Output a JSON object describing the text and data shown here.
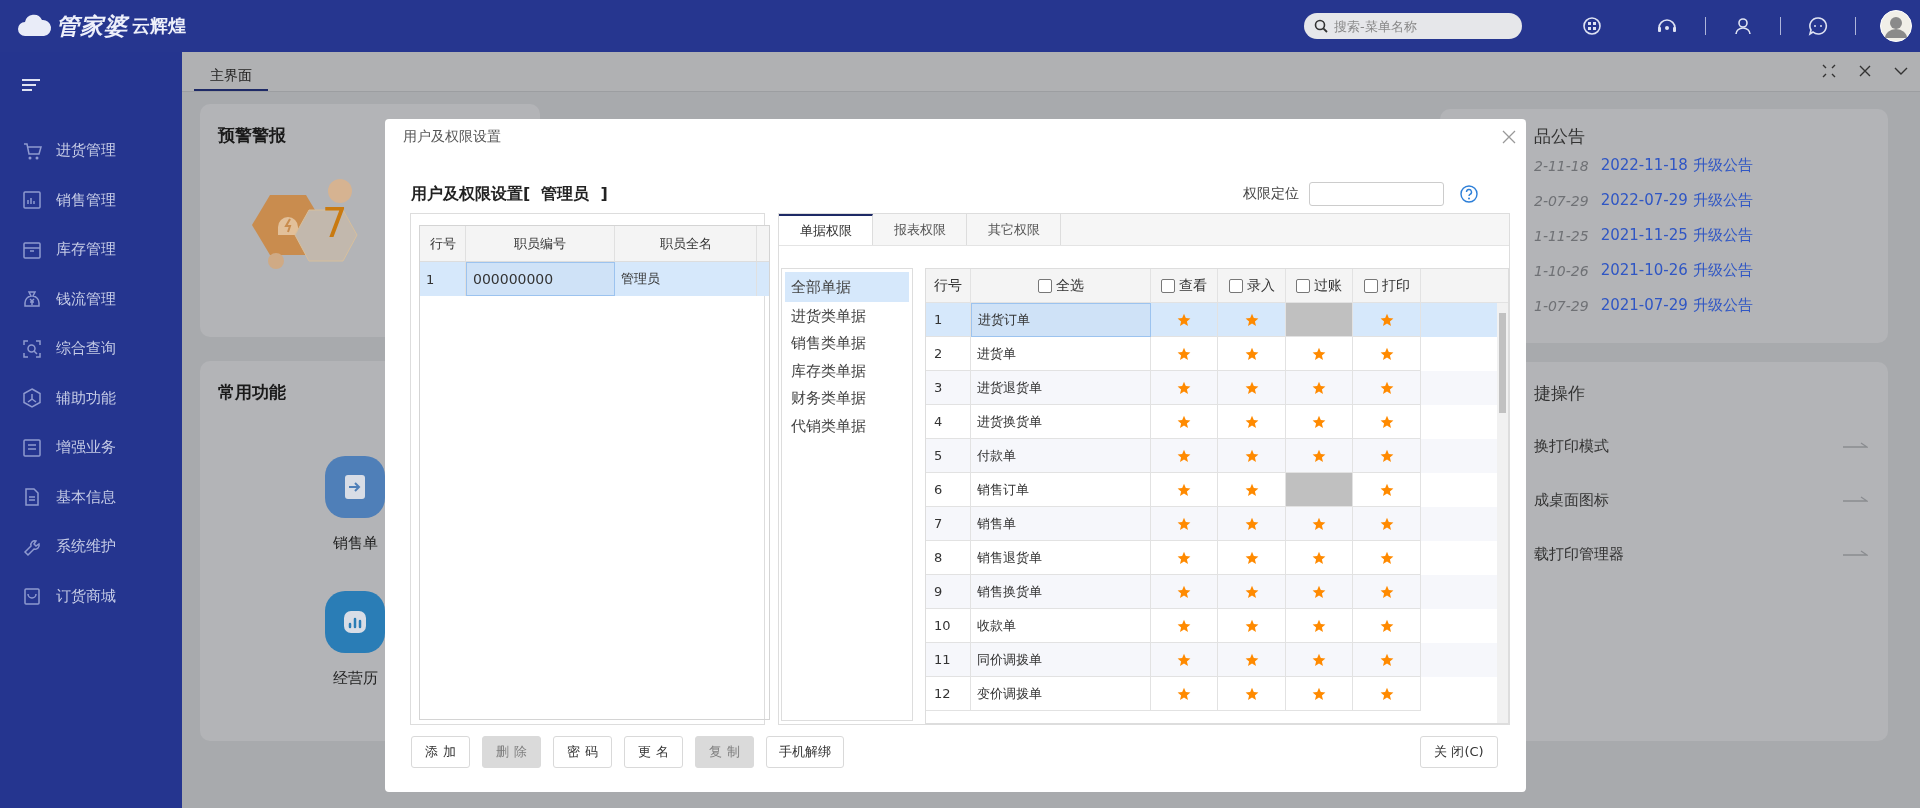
{
  "topbar": {
    "logo": {
      "brand": "管家婆",
      "product": "云辉煌"
    },
    "search": {
      "placeholder": "搜索-菜单名称"
    }
  },
  "sidebar": {
    "items": [
      {
        "label": "进货管理"
      },
      {
        "label": "销售管理"
      },
      {
        "label": "库存管理"
      },
      {
        "label": "钱流管理"
      },
      {
        "label": "综合查询"
      },
      {
        "label": "辅助功能"
      },
      {
        "label": "增强业务"
      },
      {
        "label": "基本信息"
      },
      {
        "label": "系统维护"
      },
      {
        "label": "订货商城"
      }
    ]
  },
  "page_tabs": [
    {
      "label": "主界面",
      "selected": true
    }
  ],
  "dashboard": {
    "alerts": {
      "title": "预警警报",
      "count": "7"
    },
    "shortcuts": {
      "title": "常用功能",
      "items": [
        {
          "label": "销售单"
        },
        {
          "label": "经营历"
        }
      ]
    },
    "notices": {
      "title": "品公告",
      "items": [
        {
          "date": "2-11-18",
          "link": "2022-11-18 升级公告"
        },
        {
          "date": "2-07-29",
          "link": "2022-07-29 升级公告"
        },
        {
          "date": "1-11-25",
          "link": "2021-11-25 升级公告"
        },
        {
          "date": "1-10-26",
          "link": "2021-10-26 升级公告"
        },
        {
          "date": "1-07-29",
          "link": "2021-07-29 升级公告"
        }
      ]
    },
    "quick_ops": {
      "title": "捷操作",
      "items": [
        "换打印模式",
        "成桌面图标",
        "载打印管理器"
      ]
    }
  },
  "dialog": {
    "title": "用户及权限设置",
    "heading": "用户及权限设置[  管理员  ]",
    "locate": {
      "label": "权限定位"
    },
    "users": {
      "columns": [
        "行号",
        "职员编号",
        "职员全名"
      ],
      "rows": [
        {
          "cells": [
            "1",
            "000000000",
            "管理员"
          ],
          "selected": true
        }
      ]
    },
    "perm_tabs": [
      {
        "label": "单据权限",
        "selected": true
      },
      {
        "label": "报表权限",
        "selected": false
      },
      {
        "label": "其它权限",
        "selected": false
      }
    ],
    "categories": [
      {
        "label": "全部单据",
        "selected": true
      },
      {
        "label": "进货类单据",
        "selected": false
      },
      {
        "label": "销售类单据",
        "selected": false
      },
      {
        "label": "库存类单据",
        "selected": false
      },
      {
        "label": "财务类单据",
        "selected": false
      },
      {
        "label": "代销类单据",
        "selected": false
      }
    ],
    "grid": {
      "columns": [
        {
          "label": "行号",
          "kind": "plain"
        },
        {
          "label": "全选",
          "kind": "check",
          "checked": false
        },
        {
          "label": "查看",
          "kind": "check",
          "checked": false
        },
        {
          "label": "录入",
          "kind": "check",
          "checked": false
        },
        {
          "label": "过账",
          "kind": "check",
          "checked": false
        },
        {
          "label": "打印",
          "kind": "check",
          "checked": false
        }
      ],
      "rows": [
        {
          "no": "1",
          "name": "进货订单",
          "selected": true,
          "perms": [
            {
              "on": true,
              "disabled": false
            },
            {
              "on": true,
              "disabled": false
            },
            {
              "on": false,
              "disabled": true
            },
            {
              "on": true,
              "disabled": false
            }
          ]
        },
        {
          "no": "2",
          "name": "进货单",
          "selected": false,
          "perms": [
            {
              "on": true,
              "disabled": false
            },
            {
              "on": true,
              "disabled": false
            },
            {
              "on": true,
              "disabled": false
            },
            {
              "on": true,
              "disabled": false
            }
          ]
        },
        {
          "no": "3",
          "name": "进货退货单",
          "selected": false,
          "perms": [
            {
              "on": true,
              "disabled": false
            },
            {
              "on": true,
              "disabled": false
            },
            {
              "on": true,
              "disabled": false
            },
            {
              "on": true,
              "disabled": false
            }
          ]
        },
        {
          "no": "4",
          "name": "进货换货单",
          "selected": false,
          "perms": [
            {
              "on": true,
              "disabled": false
            },
            {
              "on": true,
              "disabled": false
            },
            {
              "on": true,
              "disabled": false
            },
            {
              "on": true,
              "disabled": false
            }
          ]
        },
        {
          "no": "5",
          "name": "付款单",
          "selected": false,
          "perms": [
            {
              "on": true,
              "disabled": false
            },
            {
              "on": true,
              "disabled": false
            },
            {
              "on": true,
              "disabled": false
            },
            {
              "on": true,
              "disabled": false
            }
          ]
        },
        {
          "no": "6",
          "name": "销售订单",
          "selected": false,
          "perms": [
            {
              "on": true,
              "disabled": false
            },
            {
              "on": true,
              "disabled": false
            },
            {
              "on": false,
              "disabled": true
            },
            {
              "on": true,
              "disabled": false
            }
          ]
        },
        {
          "no": "7",
          "name": "销售单",
          "selected": false,
          "perms": [
            {
              "on": true,
              "disabled": false
            },
            {
              "on": true,
              "disabled": false
            },
            {
              "on": true,
              "disabled": false
            },
            {
              "on": true,
              "disabled": false
            }
          ]
        },
        {
          "no": "8",
          "name": "销售退货单",
          "selected": false,
          "perms": [
            {
              "on": true,
              "disabled": false
            },
            {
              "on": true,
              "disabled": false
            },
            {
              "on": true,
              "disabled": false
            },
            {
              "on": true,
              "disabled": false
            }
          ]
        },
        {
          "no": "9",
          "name": "销售换货单",
          "selected": false,
          "perms": [
            {
              "on": true,
              "disabled": false
            },
            {
              "on": true,
              "disabled": false
            },
            {
              "on": true,
              "disabled": false
            },
            {
              "on": true,
              "disabled": false
            }
          ]
        },
        {
          "no": "10",
          "name": "收款单",
          "selected": false,
          "perms": [
            {
              "on": true,
              "disabled": false
            },
            {
              "on": true,
              "disabled": false
            },
            {
              "on": true,
              "disabled": false
            },
            {
              "on": true,
              "disabled": false
            }
          ]
        },
        {
          "no": "11",
          "name": "同价调拨单",
          "selected": false,
          "perms": [
            {
              "on": true,
              "disabled": false
            },
            {
              "on": true,
              "disabled": false
            },
            {
              "on": true,
              "disabled": false
            },
            {
              "on": true,
              "disabled": false
            }
          ]
        },
        {
          "no": "12",
          "name": "变价调拨单",
          "selected": false,
          "perms": [
            {
              "on": true,
              "disabled": false
            },
            {
              "on": true,
              "disabled": false
            },
            {
              "on": true,
              "disabled": false
            },
            {
              "on": true,
              "disabled": false
            }
          ]
        }
      ]
    },
    "buttons": [
      {
        "label": "添 加",
        "disabled": false
      },
      {
        "label": "删 除",
        "disabled": true
      },
      {
        "label": "密 码",
        "disabled": false
      },
      {
        "label": "更 名",
        "disabled": false
      },
      {
        "label": "复 制",
        "disabled": true
      },
      {
        "label": "手机解绑",
        "disabled": false
      }
    ],
    "close_button": "关 闭(C)"
  }
}
